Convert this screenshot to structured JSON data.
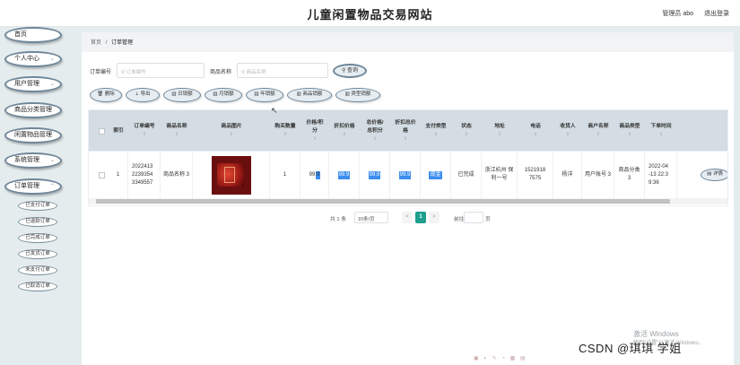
{
  "header": {
    "title": "儿童闲置物品交易网站",
    "admin_label": "管理员 abo",
    "logout": "退出登录"
  },
  "sidebar": {
    "items": [
      {
        "label": "首页",
        "has_arrow": false
      },
      {
        "label": "个人中心",
        "has_arrow": true
      },
      {
        "label": "用户管理",
        "has_arrow": true
      },
      {
        "label": "商品分类管理",
        "has_arrow": false
      },
      {
        "label": "闲置物品管理",
        "has_arrow": false
      },
      {
        "label": "系统管理",
        "has_arrow": true
      },
      {
        "label": "订单管理",
        "has_arrow": true
      }
    ],
    "subitems": [
      "已支付订单",
      "已退款订单",
      "已完成订单",
      "已发货订单",
      "未支付订单",
      "已取消订单"
    ]
  },
  "breadcrumb": {
    "home": "首页",
    "sep": "/",
    "current": "订单管理"
  },
  "search": {
    "order_no_label": "订单编号",
    "order_no_placeholder": "订单编号",
    "product_name_label": "商品名称",
    "product_name_placeholder": "商品名称",
    "search_button": "查询"
  },
  "actions": [
    "删除",
    "导出",
    "日销额",
    "月销额",
    "年销额",
    "商品销额",
    "类型销额"
  ],
  "table": {
    "headers": {
      "index": "索引",
      "order_no": "订单编号",
      "product_name": "商品名称",
      "product_image": "商品图片",
      "quantity": "购买数量",
      "price": "价格/积分",
      "discount_price": "折扣价格",
      "total": "总价格/总积分",
      "discount_total": "折扣总价格",
      "pay_type": "支付类型",
      "status": "状态",
      "address": "地址",
      "phone": "电话",
      "receiver": "收货人",
      "merchant": "商户名称",
      "category": "商品类型",
      "order_time": "下单时间"
    },
    "sort_icon": "⇕",
    "row": {
      "index": "1",
      "order_no": "2022413 2239354 3349557",
      "product_name": "商品名称 3",
      "quantity": "1",
      "price": "99.9",
      "discount_price": "99.9",
      "total": "99.9",
      "discount_total": "99.9",
      "pay_type": "现金",
      "status": "已完成",
      "address": "浙江杭州 保利一号",
      "phone": "1521918 7575",
      "receiver": "杨洋",
      "merchant": "用户账号 3",
      "category": "商品分类 3",
      "order_time": "2022-04 -13 22:3 9:36",
      "detail_button": "详情"
    }
  },
  "pagination": {
    "total": "共 1 条",
    "page_size": "10条/页",
    "current_page": "1",
    "goto_label": "前往",
    "page_suffix": "页",
    "prev": "<",
    "next": ">"
  },
  "watermark": {
    "line1": "激活 Windows",
    "line2": "转到\"设置\"以激活 Windows。"
  },
  "csdn_mark": "CSDN @琪琪 学姐"
}
